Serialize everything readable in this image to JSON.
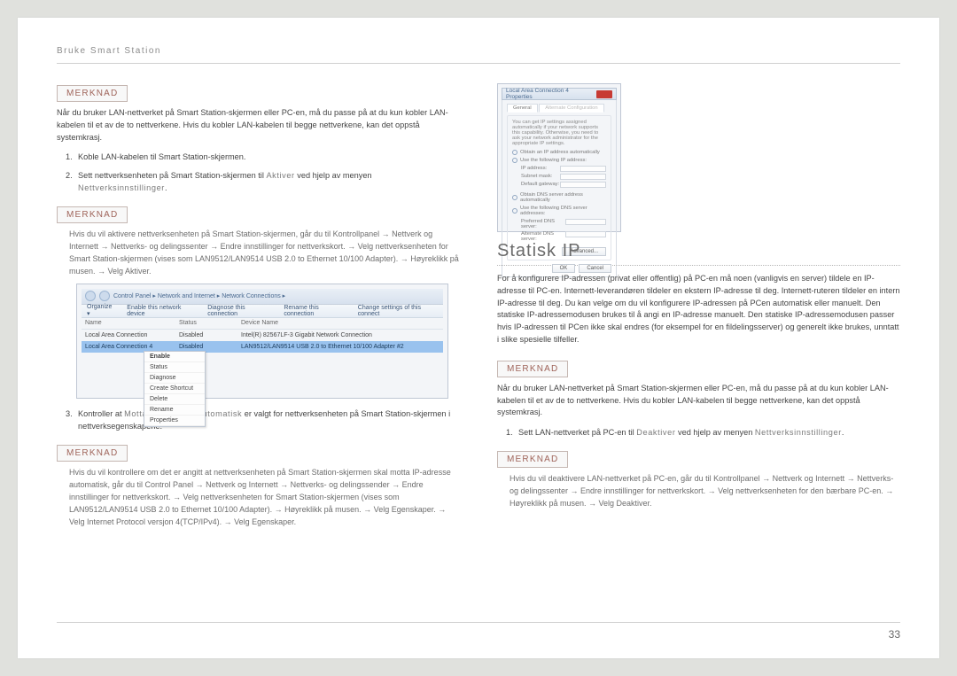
{
  "header": "Bruke Smart Station",
  "pageNumber": "33",
  "merknadLabel": "MERKNAD",
  "col1": {
    "warn1": "Når du bruker LAN-nettverket på Smart Station-skjermen eller PC-en, må du passe på at du kun kobler LAN-kabelen til et av de to nettverkene. Hvis du kobler LAN-kabelen til begge nettverkene, kan det oppstå systemkrasj.",
    "step1": "Koble LAN-kabelen til Smart Station-skjermen.",
    "step2_a": "Sett nettverksenheten på Smart Station-skjermen til ",
    "step2_b": "Aktiver",
    "step2_c": " ved hjelp av menyen ",
    "step2_d": "Nettverksinnstillinger",
    "step2_e": ".",
    "note2": "Hvis du vil aktivere nettverksenheten på Smart Station-skjermen, går du til Kontrollpanel → Nettverk og Internett → Nettverks- og delingssenter → Endre innstillinger for nettverkskort. → Velg nettverksenheten for Smart Station-skjermen (vises som LAN9512/LAN9514 USB 2.0 to Ethernet 10/100 Adapter). → Høyreklikk på musen. → Velg Aktiver.",
    "step3_a": "Kontroller at ",
    "step3_b": "Motta IP-adresse automatisk",
    "step3_c": " er valgt for nettverksenheten på Smart Station-skjermen i nettverksegenskapene.",
    "note3": "Hvis du vil kontrollere om det er angitt at nettverksenheten på Smart Station-skjermen skal motta IP-adresse automatisk, går du til Control Panel → Nettverk og Internett → Nettverks- og delingssender → Endre innstillinger for nettverkskort. → Velg nettverksenheten for Smart Station-skjermen (vises som LAN9512/LAN9514 USB 2.0 to Ethernet 10/100 Adapter). → Høyreklikk på musen. → Velg Egenskaper. → Velg Internet Protocol versjon 4(TCP/IPv4). → Velg Egenskaper.",
    "winNav": "Control Panel  ▸  Network and Internet  ▸  Network Connections  ▸",
    "toolbar": {
      "t1": "Organize ▾",
      "t2": "Enable this network device",
      "t3": "Diagnose this connection",
      "t4": "Rename this connection",
      "t5": "Change settings of this connect"
    },
    "ncHeader": {
      "h1": "Name",
      "h2": "Status",
      "h3": "Device Name"
    },
    "ncRow1": {
      "c1": "Local Area Connection",
      "c2": "Disabled",
      "c3": "Intel(R) 82567LF-3 Gigabit Network Connection"
    },
    "ncRow2": {
      "c1": "Local Area Connection 4",
      "c2": "Disabled",
      "c3": "LAN9512/LAN9514 USB 2.0 to Ethernet 10/100 Adapter #2"
    },
    "ctx": {
      "c1": "Enable",
      "c2": "Status",
      "c3": "Diagnose",
      "c4": "Create Shortcut",
      "c5": "Delete",
      "c6": "Rename",
      "c7": "Properties"
    }
  },
  "col2": {
    "ipTitle": "Local Area Connection 4 Properties",
    "ipTab": "General",
    "ipTab2": "Alternate Configuration",
    "ipDesc": "You can get IP settings assigned automatically if your network supports this capability. Otherwise, you need to ask your network administrator for the appropriate IP settings.",
    "ipOpt1": "Obtain an IP address automatically",
    "ipOpt2": "Use the following IP address:",
    "ipF1": "IP address:",
    "ipF2": "Subnet mask:",
    "ipF3": "Default gateway:",
    "ipOpt3": "Obtain DNS server address automatically",
    "ipOpt4": "Use the following DNS server addresses:",
    "ipF4": "Preferred DNS server:",
    "ipF5": "Alternate DNS server:",
    "ipAdv": "Advanced...",
    "ipOk": "OK",
    "ipCancel": "Cancel",
    "sectionTitle": "Statisk IP",
    "intro": "For å konfigurere IP-adressen (privat eller offentlig) på PC-en må noen (vanligvis en server) tildele en IP-adresse til PC-en.  Internett-leverandøren tildeler en ekstern IP-adresse til deg. Internett-ruteren tildeler en intern IP-adresse til deg. Du kan velge om du vil konfigurere IP-adressen på PCen automatisk eller manuelt. Den statiske IP-adressemodusen brukes til å angi en IP-adresse manuelt. Den statiske IP-adressemodusen passer hvis IP-adressen til PCen ikke skal endres (for eksempel for en fildelingsserver) og generelt ikke brukes, unntatt i slike spesielle tilfeller.",
    "warn1": "Når du bruker LAN-nettverket på Smart Station-skjermen eller PC-en, må du passe på at du kun kobler LAN-kabelen til et av de to nettverkene. Hvis du kobler LAN-kabelen til begge nettverkene, kan det oppstå systemkrasj.",
    "step1_a": "Sett LAN-nettverket på PC-en til ",
    "step1_b": "Deaktiver",
    "step1_c": " ved hjelp av menyen ",
    "step1_d": "Nettverksinnstillinger",
    "step1_e": ".",
    "note1": "Hvis du vil deaktivere LAN-nettverket på PC-en, går du til Kontrollpanel → Nettverk og Internett → Nettverks- og delingssenter → Endre innstillinger for nettverkskort. → Velg nettverksenheten for den bærbare PC-en. → Høyreklikk på musen. → Velg Deaktiver."
  }
}
